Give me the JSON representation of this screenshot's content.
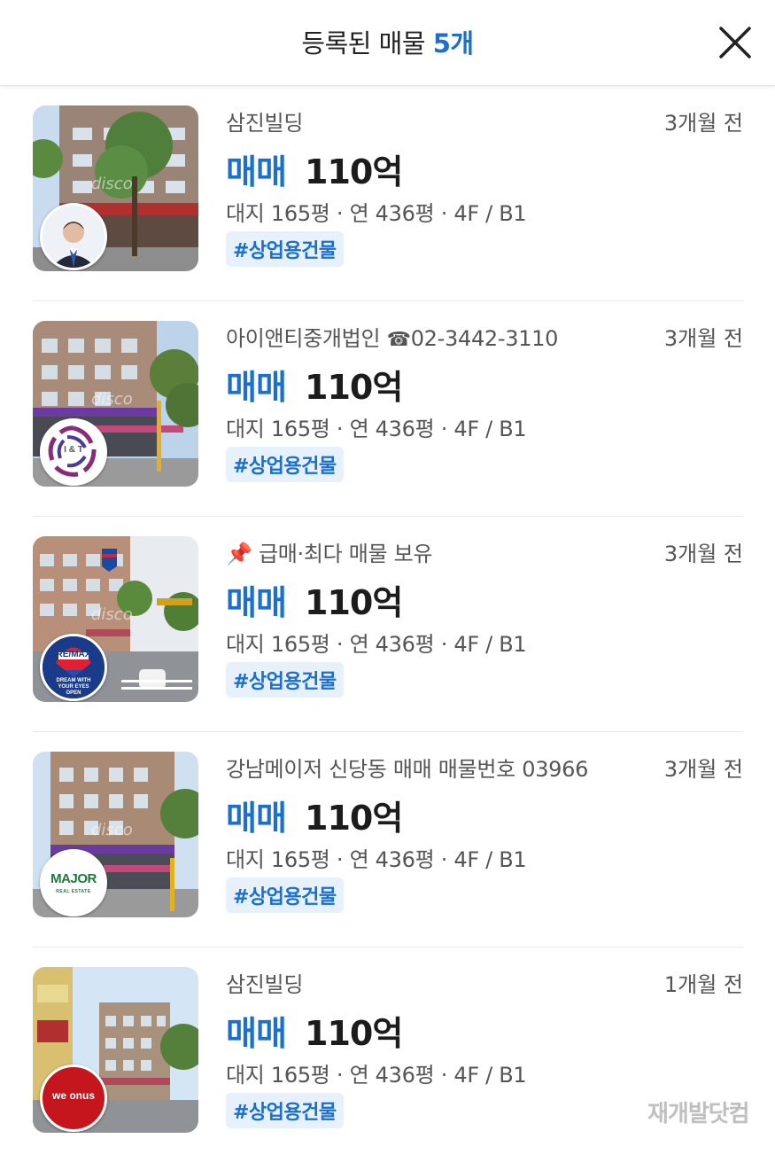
{
  "header": {
    "title": "등록된 매물",
    "count": "5개",
    "close_icon": "close-x-icon"
  },
  "listings": [
    {
      "agent": "삼진빌딩",
      "time": "3개월 전",
      "deal_type": "매매",
      "price": "110억",
      "details": "대지 165평 · 연 436평 · 4F / B1",
      "tag": "#상업용건물",
      "watermark": "disco",
      "badge": "agent-photo-avatar"
    },
    {
      "agent": "아이앤티중개법인",
      "phone_icon": "☎",
      "phone": "02-3442-3110",
      "time": "3개월 전",
      "deal_type": "매매",
      "price": "110억",
      "details": "대지 165평 · 연 436평 · 4F / B1",
      "tag": "#상업용건물",
      "badge_text": "I & T",
      "watermark": "disco"
    },
    {
      "pin_icon": "📌",
      "agent": "급매·최다 매물 보유",
      "time": "3개월 전",
      "deal_type": "매매",
      "price": "110억",
      "details": "대지 165평 · 연 436평 · 4F / B1",
      "tag": "#상업용건물",
      "badge_text": "RE/MAX",
      "badge_sub": "DREAM WITH YOUR EYES OPEN",
      "watermark": "disco"
    },
    {
      "agent": "강남메이저 신당동 매매 매물번호 03966",
      "time": "3개월 전",
      "deal_type": "매매",
      "price": "110억",
      "details": "대지 165평 · 연 436평 · 4F / B1",
      "tag": "#상업용건물",
      "badge_text": "MAJOR",
      "badge_sub": "REAL ESTATE",
      "watermark": "disco"
    },
    {
      "agent": "삼진빌딩",
      "time": "1개월 전",
      "deal_type": "매매",
      "price": "110억",
      "details": "대지 165평 · 연 436평 · 4F / B1",
      "tag": "#상업용건물",
      "badge_text": "we onus"
    }
  ],
  "site_watermark": "재개발닷컴",
  "colors": {
    "accent": "#1a6fd0",
    "tag_bg": "#e6f1fb"
  }
}
